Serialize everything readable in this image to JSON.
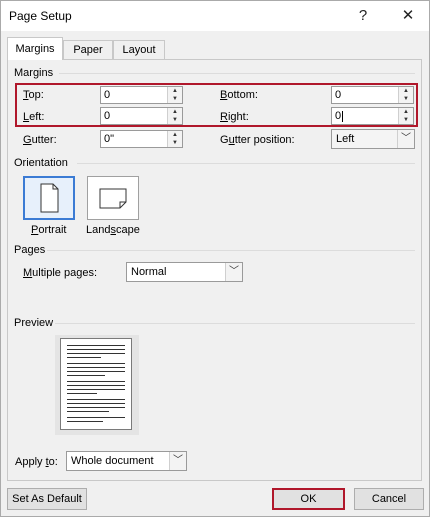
{
  "window": {
    "title": "Page Setup",
    "help_glyph": "?",
    "close_glyph": "✕"
  },
  "tabs": [
    {
      "label": "Margins"
    },
    {
      "label": "Paper"
    },
    {
      "label": "Layout"
    }
  ],
  "margins": {
    "group_label": "Margins",
    "top": {
      "prefix": "T",
      "rest": "op:",
      "value": "0"
    },
    "bottom": {
      "prefix": "B",
      "rest": "ottom:",
      "value": "0"
    },
    "left": {
      "prefix": "L",
      "rest": "eft:",
      "value": "0"
    },
    "right": {
      "prefix": "R",
      "rest": "ight:",
      "value": "0"
    },
    "gutter": {
      "prefix": "G",
      "rest": "utter:",
      "value": "0\""
    },
    "gutter_position": {
      "pre": "G",
      "underlined": "u",
      "rest": "tter position:",
      "value": "Left"
    }
  },
  "orientation": {
    "group_label": "Orientation",
    "portrait": {
      "prefix": "P",
      "rest": "ortrait"
    },
    "landscape": {
      "pre": "Land",
      "underlined": "s",
      "rest": "cape"
    }
  },
  "pages": {
    "group_label": "Pages",
    "multiple_pages": {
      "prefix": "M",
      "rest": "ultiple pages:",
      "value": "Normal"
    }
  },
  "preview": {
    "group_label": "Preview",
    "apply_to": {
      "pre": "Apply ",
      "underlined": "t",
      "rest": "o:",
      "value": "Whole document"
    }
  },
  "buttons": {
    "set_default": "Set As Default",
    "ok": "OK",
    "cancel": "Cancel"
  },
  "colors": {
    "highlight": "#b0172b",
    "selected": "#3b7bd4"
  }
}
